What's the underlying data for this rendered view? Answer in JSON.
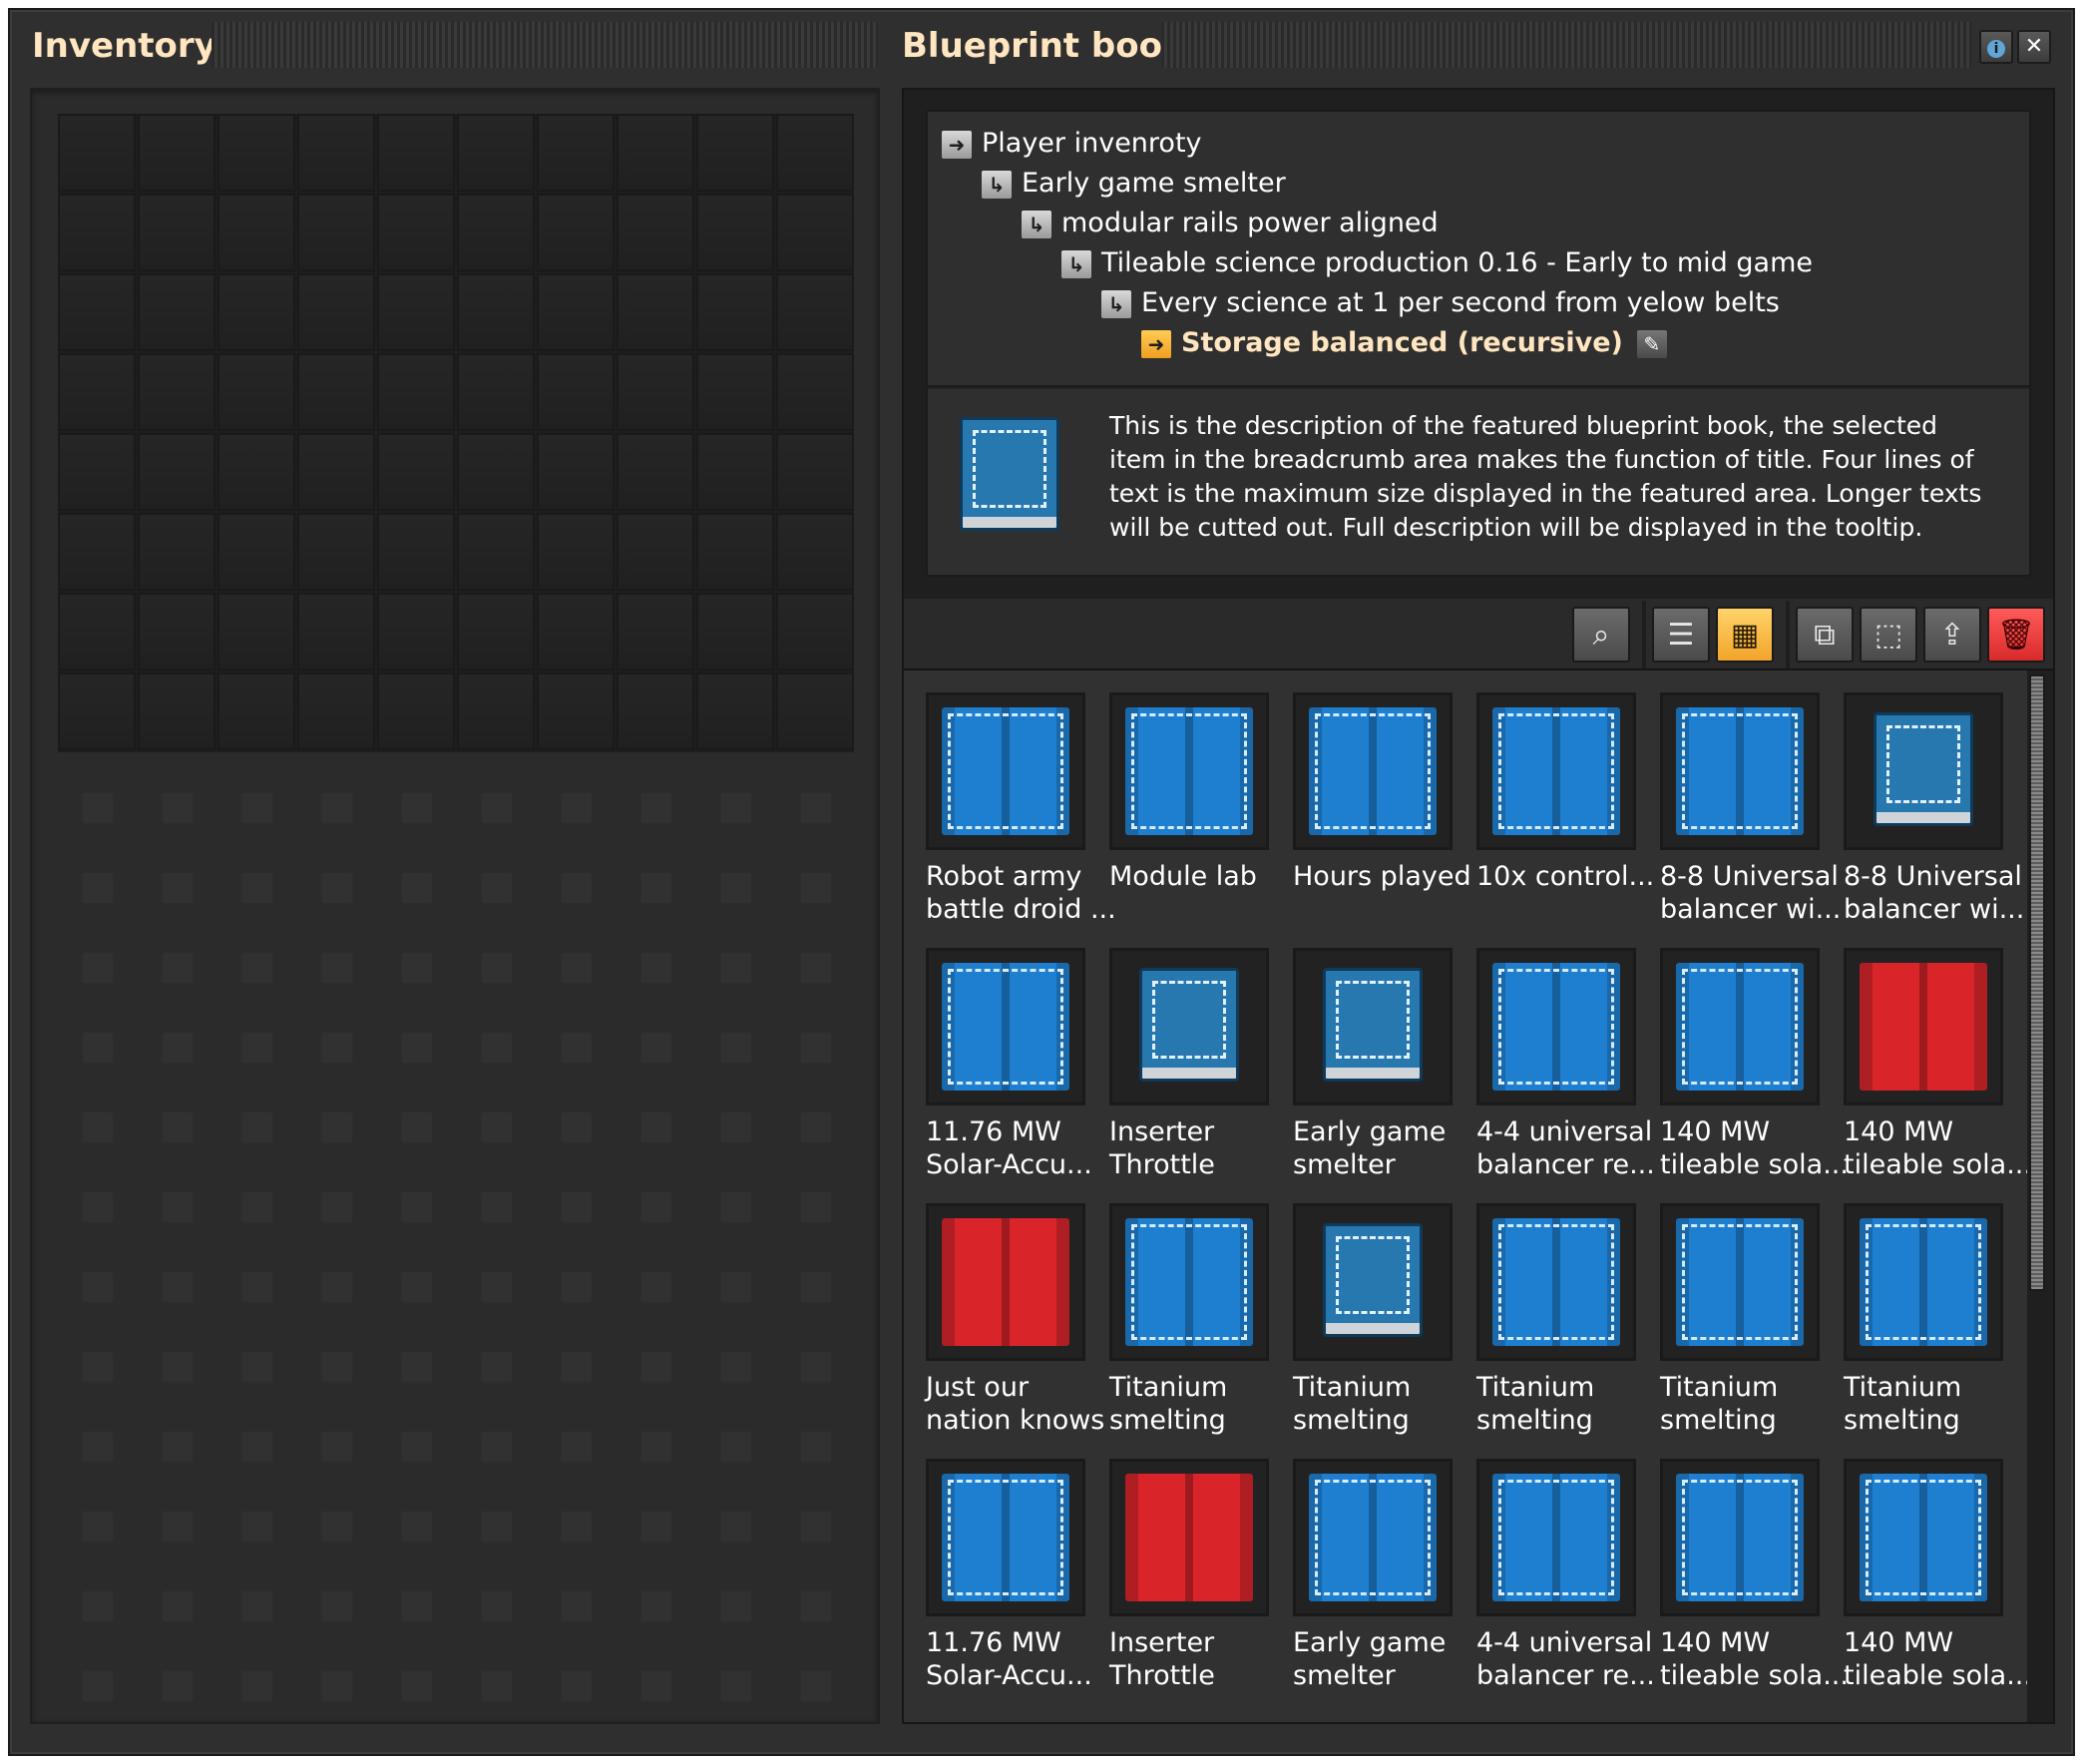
{
  "inventory": {
    "title": "Inventory"
  },
  "blueprint_book": {
    "title": "Blueprint book",
    "breadcrumbs": [
      {
        "label": "Player invenroty",
        "icon": "arrow-right-icon"
      },
      {
        "label": "Early game smelter",
        "icon": "return-arrow-icon"
      },
      {
        "label": "modular rails power aligned",
        "icon": "return-arrow-icon"
      },
      {
        "label": "Tileable science production 0.16 - Early to mid game",
        "icon": "return-arrow-icon"
      },
      {
        "label": "Every science at 1 per second from yelow belts",
        "icon": "return-arrow-icon"
      },
      {
        "label": "Storage balanced (recursive)",
        "icon": "arrow-right-icon"
      }
    ],
    "description": "This is the description of the featured blueprint book, the selected item in the breadcrumb area makes the function of title. Four lines of text is the maximum size displayed in the featured area. Longer texts will be cutted out. Full description will be displayed in the tooltip.",
    "title_buttons": {
      "info": "i",
      "close": "✕"
    },
    "toolbar": {
      "search": "⌕",
      "list_view": "☰",
      "grid_view": "▦",
      "copy": "⧉",
      "select": "⬚",
      "export": "⇪",
      "delete": "🗑"
    },
    "accent_color": "#f2a42a",
    "items": [
      {
        "label": "Robot army\nbattle droid ...",
        "kind": "blueprint",
        "color": "blue"
      },
      {
        "label": "Module lab",
        "kind": "blueprint",
        "color": "blue"
      },
      {
        "label": "Hours played",
        "kind": "blueprint",
        "color": "blue"
      },
      {
        "label": "10x control...",
        "kind": "blueprint",
        "color": "blue"
      },
      {
        "label": "8-8 Universal\nbalancer wi...",
        "kind": "blueprint",
        "color": "blue"
      },
      {
        "label": "8-8 Universal\nbalancer wi...",
        "kind": "book",
        "color": "blue"
      },
      {
        "label": "11.76 MW\nSolar-Accu...",
        "kind": "blueprint",
        "color": "blue"
      },
      {
        "label": "Inserter\nThrottle",
        "kind": "book",
        "color": "blue"
      },
      {
        "label": "Early game\nsmelter",
        "kind": "book",
        "color": "blue"
      },
      {
        "label": "4-4 universal\nbalancer re...",
        "kind": "blueprint",
        "color": "blue"
      },
      {
        "label": "140 MW\ntileable sola...",
        "kind": "blueprint",
        "color": "blue"
      },
      {
        "label": "140 MW\ntileable sola...",
        "kind": "blueprint",
        "color": "red"
      },
      {
        "label": "Just our\nnation knows",
        "kind": "blueprint",
        "color": "red"
      },
      {
        "label": "Titanium\nsmelting",
        "kind": "blueprint",
        "color": "blue"
      },
      {
        "label": "Titanium\nsmelting",
        "kind": "book",
        "color": "blue"
      },
      {
        "label": "Titanium\nsmelting",
        "kind": "blueprint",
        "color": "blue"
      },
      {
        "label": "Titanium\nsmelting",
        "kind": "blueprint",
        "color": "blue"
      },
      {
        "label": "Titanium\nsmelting",
        "kind": "blueprint",
        "color": "blue"
      },
      {
        "label": "11.76 MW\nSolar-Accu...",
        "kind": "blueprint",
        "color": "blue"
      },
      {
        "label": "Inserter\nThrottle",
        "kind": "blueprint",
        "color": "red"
      },
      {
        "label": "Early game\nsmelter",
        "kind": "blueprint",
        "color": "blue"
      },
      {
        "label": "4-4 universal\nbalancer re...",
        "kind": "blueprint",
        "color": "blue"
      },
      {
        "label": "140 MW\ntileable sola...",
        "kind": "blueprint",
        "color": "blue"
      },
      {
        "label": "140 MW\ntileable sola...",
        "kind": "blueprint",
        "color": "blue"
      }
    ]
  }
}
